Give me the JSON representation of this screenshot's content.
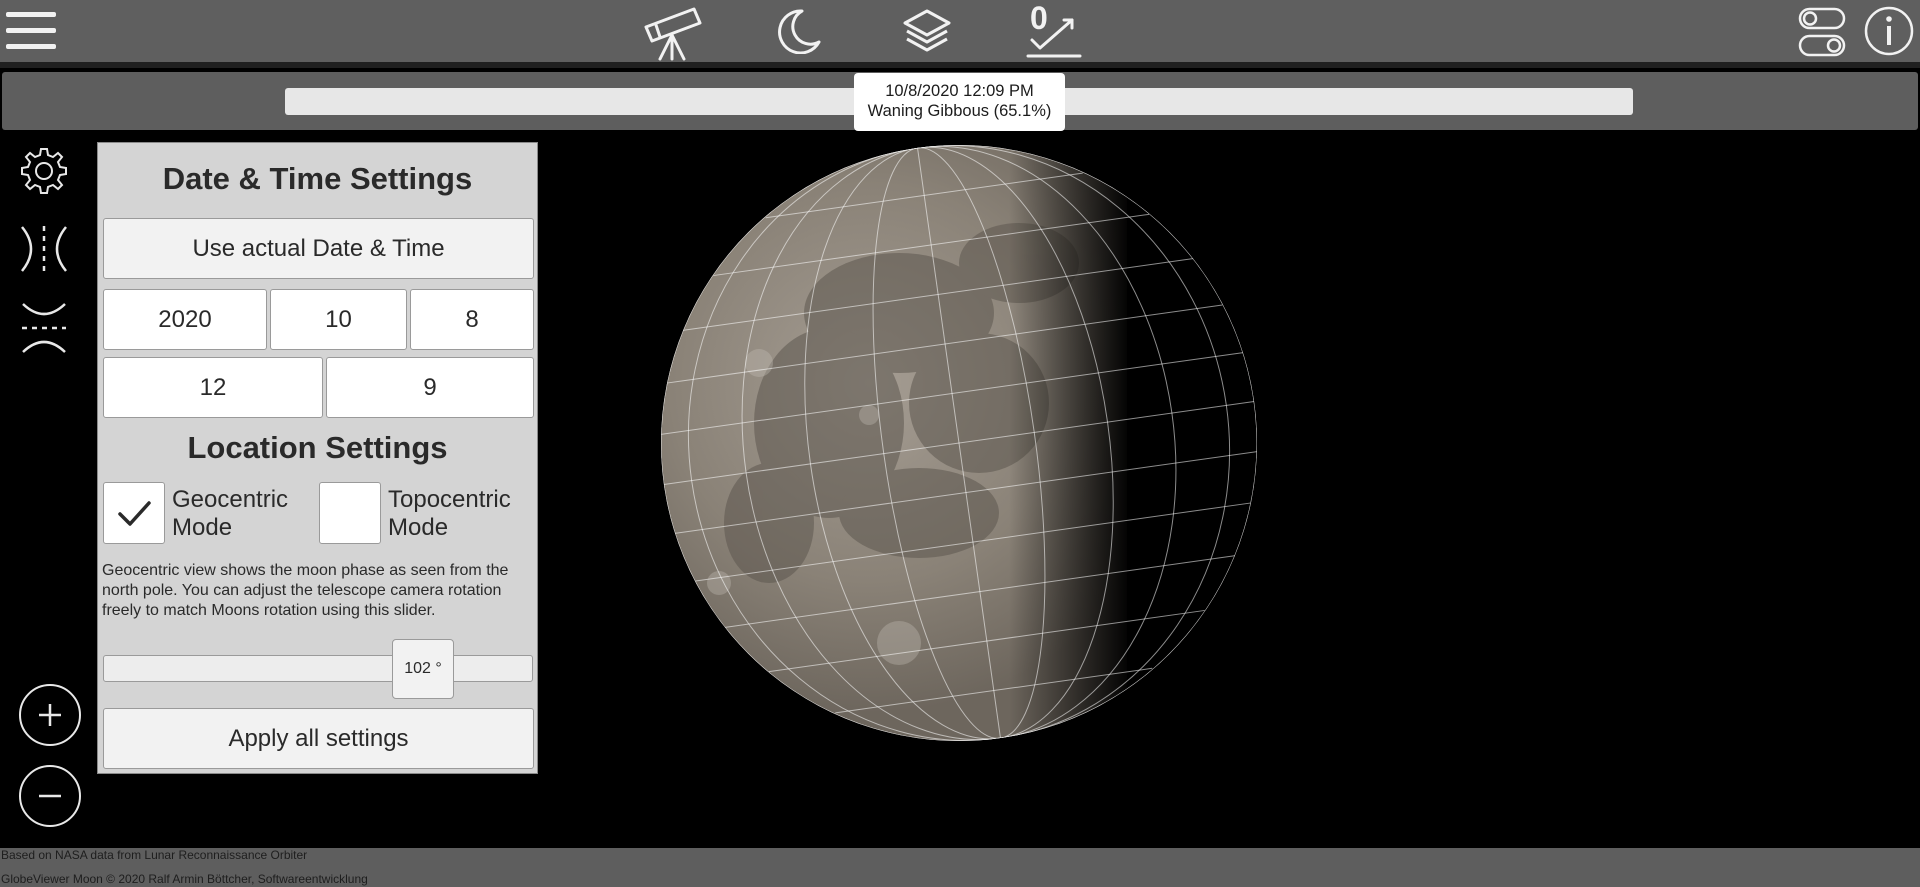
{
  "toolbar": {
    "left": {
      "menu_icon": "hamburger-menu-icon"
    },
    "center": [
      {
        "name": "telescope-icon"
      },
      {
        "name": "crescent-moon-icon"
      },
      {
        "name": "layers-icon"
      },
      {
        "name": "graph-counter-icon",
        "badge": "0"
      }
    ],
    "right": [
      {
        "name": "toggle-switches-icon"
      },
      {
        "name": "info-icon"
      }
    ]
  },
  "timeline": {
    "tooltip_date": "10/8/2020 12:09 PM",
    "tooltip_phase": "Waning Gibbous (65.1%)"
  },
  "side_icons": [
    "gear-icon",
    "horizontal-libration-icon",
    "vertical-libration-icon"
  ],
  "panel": {
    "date_time_title": "Date & Time Settings",
    "use_actual_label": "Use actual Date & Time",
    "year": "2020",
    "month": "10",
    "day": "8",
    "hour": "12",
    "minute": "9",
    "location_title": "Location Settings",
    "geocentric": {
      "label_line1": "Geocentric",
      "label_line2": "Mode",
      "checked": true
    },
    "topocentric": {
      "label_line1": "Topocentric",
      "label_line2": "Mode",
      "checked": false
    },
    "description": "Geocentric view shows the moon phase as seen from the north pole. You can adjust the telescope camera rotation freely to match Moons rotation using this slider.",
    "rotation_value": "102 °",
    "apply_label": "Apply all settings"
  },
  "zoom": {
    "in_icon": "zoom-in-icon",
    "out_icon": "zoom-out-icon"
  },
  "footer": {
    "line1": "Based on NASA data from Lunar Reconnaissance Orbiter",
    "line2": "GlobeViewer Moon © 2020 Ralf Armin Böttcher, Softwareentwicklung"
  },
  "colors": {
    "toolbar_bg": "#5f5f5f",
    "panel_bg": "#d4d4d4",
    "icon_white": "#f2f2f2",
    "moon_surface": "#8d857b",
    "grid_lines": "#ffffff"
  }
}
